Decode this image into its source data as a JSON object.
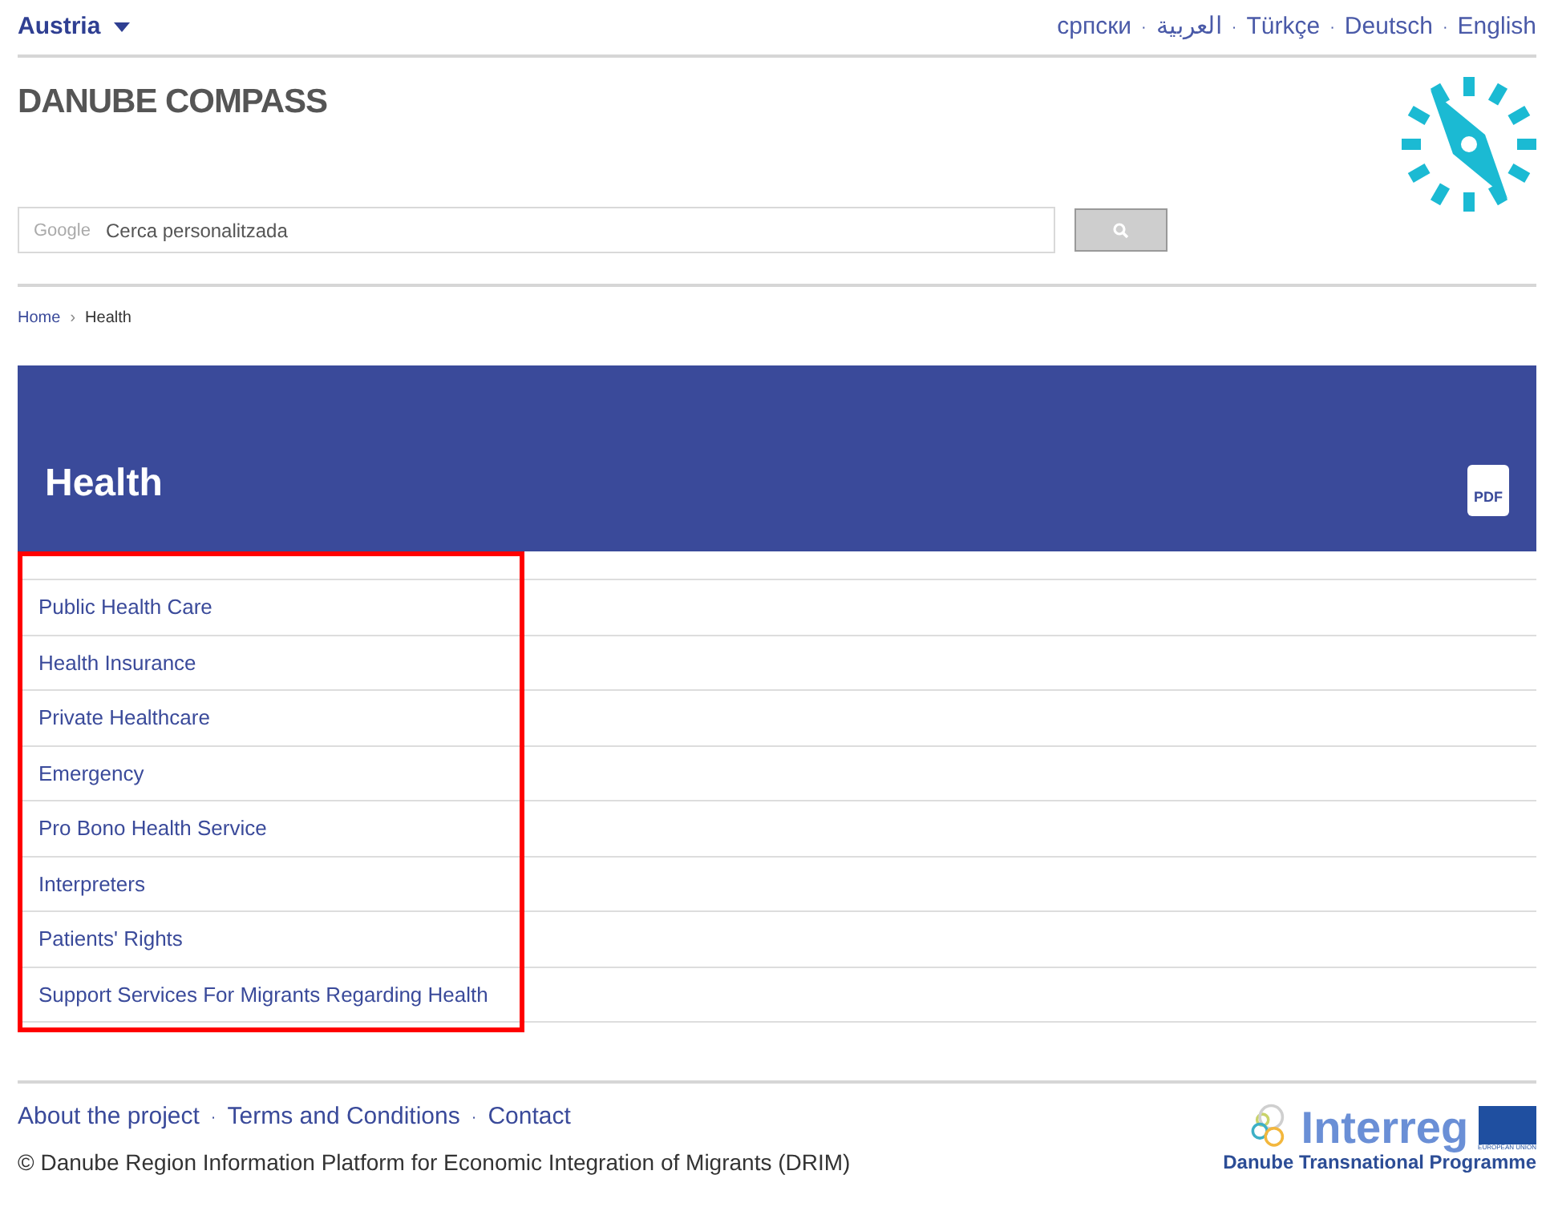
{
  "country": {
    "label": "Austria"
  },
  "languages": [
    "српски",
    "العربية",
    "Türkçe",
    "Deutsch",
    "English"
  ],
  "language_separator": "·",
  "site_title": "DANUBE COMPASS",
  "search": {
    "brand": "Google",
    "placeholder": "Cerca personalitzada"
  },
  "breadcrumb": [
    {
      "label": "Home"
    },
    {
      "label": "Health"
    }
  ],
  "breadcrumb_separator": "›",
  "banner": {
    "title": "Health",
    "download": "PDF"
  },
  "topics": [
    "Public Health Care",
    "Health Insurance",
    "Private Healthcare",
    "Emergency",
    "Pro Bono Health Service",
    "Interpreters",
    "Patients' Rights",
    "Support Services For Migrants Regarding Health"
  ],
  "footer": {
    "separator": "·",
    "links": [
      "About the project",
      "Terms and Conditions",
      "Contact"
    ],
    "copyright": "© Danube Region Information Platform for Economic Integration of Migrants (DRIM)",
    "logo": {
      "name": "Interreg",
      "eu": "EUROPEAN UNION",
      "programme": "Danube Transnational Programme"
    }
  }
}
